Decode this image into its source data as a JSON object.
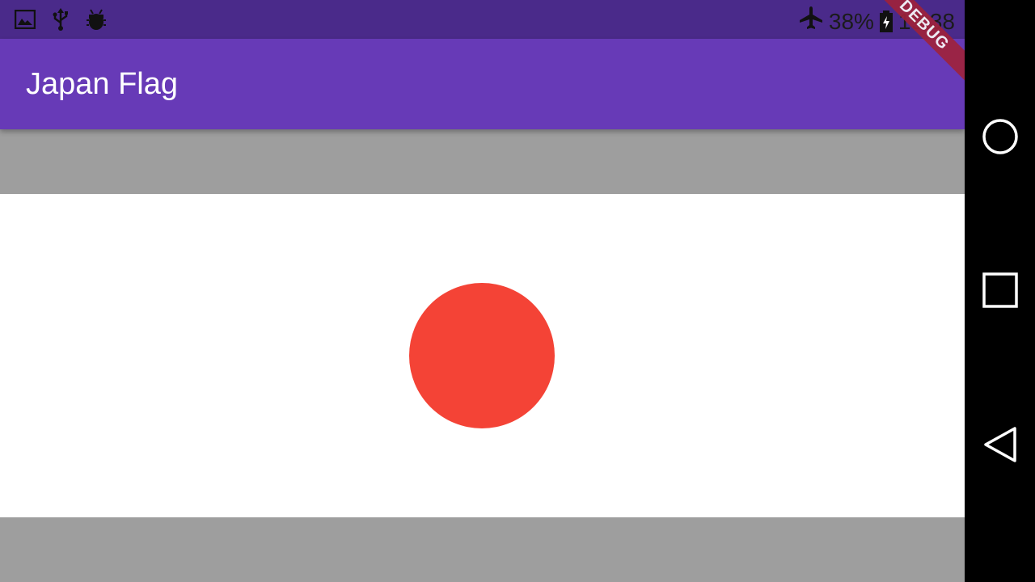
{
  "status_bar": {
    "left_icons": [
      "image-icon",
      "usb-icon",
      "android-debug-icon"
    ],
    "battery_percent": "38%",
    "time": "19:38",
    "right_icons": [
      "airplane-mode-icon",
      "battery-charging-icon"
    ]
  },
  "app_bar": {
    "title": "Japan Flag",
    "color": "#673ab7"
  },
  "debug_banner": {
    "label": "DEBUG"
  },
  "flag": {
    "background": "#ffffff",
    "disc_color": "#f44336"
  },
  "nav_bar": {
    "buttons": [
      "home-circle-icon",
      "recents-square-icon",
      "back-triangle-icon"
    ]
  },
  "colors": {
    "status_bar": "#4a2a8a",
    "page_background": "#9e9e9e"
  }
}
